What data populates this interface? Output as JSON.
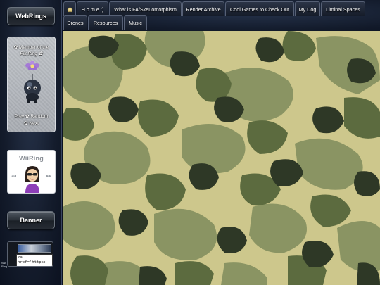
{
  "sidebar": {
    "webrings_label": "WebRings",
    "pik_ring": {
      "line1": "✿ Member of the",
      "line2": "Pik Ring ✿",
      "prev": "Prev",
      "random": "Random",
      "next": "Next"
    },
    "wiiring": {
      "title": "WiiRing",
      "left_arrow": "◂◂",
      "right_arrow": "▸▸"
    },
    "banner_label": "Banner",
    "badge_code": "<a\nhref='https:",
    "tiny_text": "Ww\nRing"
  },
  "nav": {
    "home_label": "H o m e :)",
    "tabs_row1": [
      "What is FA/Skeuomorphism",
      "Render Archive",
      "Cool Games to Check Out",
      "My Dog",
      "Liminal Spaces"
    ],
    "tabs_row2": [
      "Drones",
      "Resources",
      "Music"
    ]
  },
  "colors": {
    "camo_base": "#cdc78c",
    "camo_olive": "#8a9463",
    "camo_moss": "#5c6b3f",
    "camo_dark": "#2e3826",
    "sidebar_bg": "#141c2c"
  },
  "icons": {
    "home": "home-icon",
    "flower": "flower-icon",
    "pikmin": "pikmin-icon",
    "mii": "mii-icon"
  }
}
